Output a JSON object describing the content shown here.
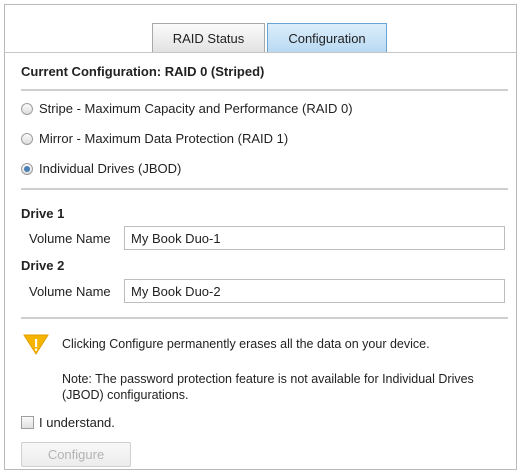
{
  "tabs": [
    {
      "label": "RAID Status",
      "active": false
    },
    {
      "label": "Configuration",
      "active": true
    }
  ],
  "current_configuration": "Current Configuration:  RAID 0 (Striped)",
  "raid_options": [
    {
      "label": "Stripe - Maximum Capacity and Performance (RAID 0)",
      "selected": false
    },
    {
      "label": "Mirror - Maximum Data Protection (RAID 1)",
      "selected": false
    },
    {
      "label": "Individual Drives (JBOD)",
      "selected": true
    }
  ],
  "drives": [
    {
      "title": "Drive 1",
      "volume_label": "Volume Name",
      "volume_value": "My Book Duo-1"
    },
    {
      "title": "Drive 2",
      "volume_label": "Volume Name",
      "volume_value": "My Book Duo-2"
    }
  ],
  "warning": {
    "icon": "warning-icon",
    "text": "Clicking Configure permanently erases all the data on your device.",
    "note": "Note: The password protection feature is not available for Individual Drives (JBOD) configurations.",
    "color": "#f5b400"
  },
  "confirm_label": "I understand.",
  "configure_button": "Configure",
  "colors": {
    "active_tab": "#b7d8f2",
    "radio_selected": "#4a7fb5"
  }
}
